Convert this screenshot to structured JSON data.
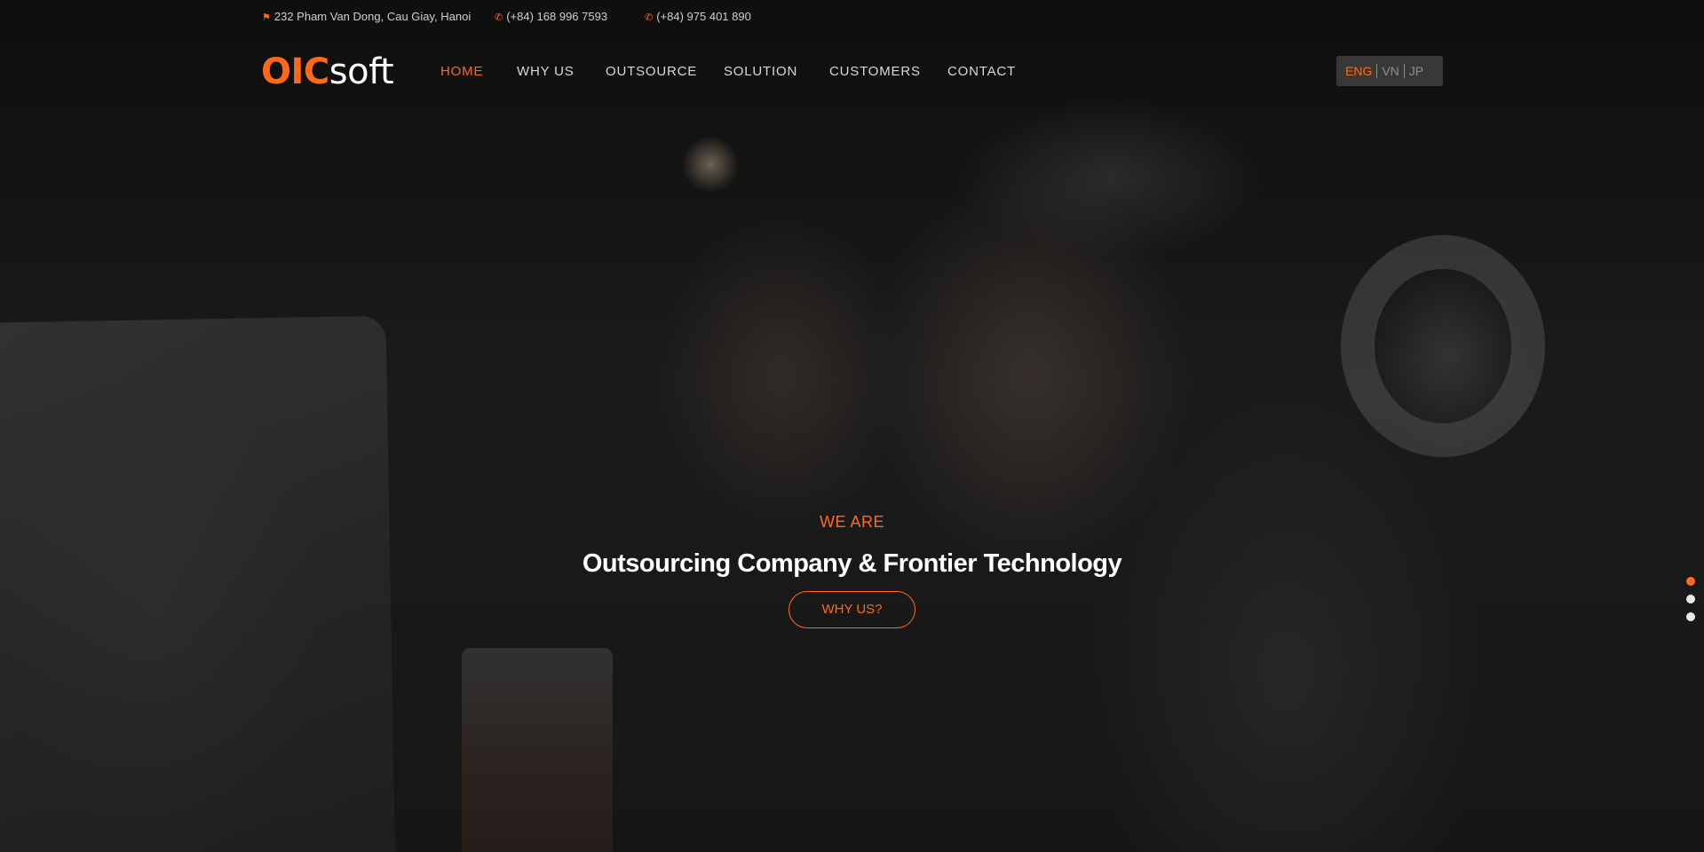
{
  "topbar": {
    "address": "232 Pham Van Dong, Cau Giay, Hanoi",
    "phone1": "(+84) 168 996 7593",
    "phone2": "(+84) 975 401 890",
    "address_icon": "map-marker-icon",
    "phone_icon": "phone-icon"
  },
  "logo": {
    "part1": "OIC",
    "part2": "soft"
  },
  "nav": {
    "items": [
      {
        "label": "HOME",
        "active": true
      },
      {
        "label": "WHY US",
        "active": false
      },
      {
        "label": "OUTSOURCE",
        "active": false
      },
      {
        "label": "SOLUTION",
        "active": false
      },
      {
        "label": "CUSTOMERS",
        "active": false
      },
      {
        "label": "CONTACT",
        "active": false
      }
    ]
  },
  "language": {
    "options": [
      "ENG",
      "VN",
      "JP"
    ],
    "selected": "ENG"
  },
  "hero": {
    "eyebrow": "WE ARE",
    "headline": "Outsourcing Company & Frontier Technology",
    "cta_label": "WHY US?"
  },
  "slider": {
    "count": 3,
    "active_index": 0
  },
  "colors": {
    "accent": "#ff6a1a",
    "text_light": "#ffffff",
    "nav_text": "#d8d8d8"
  }
}
